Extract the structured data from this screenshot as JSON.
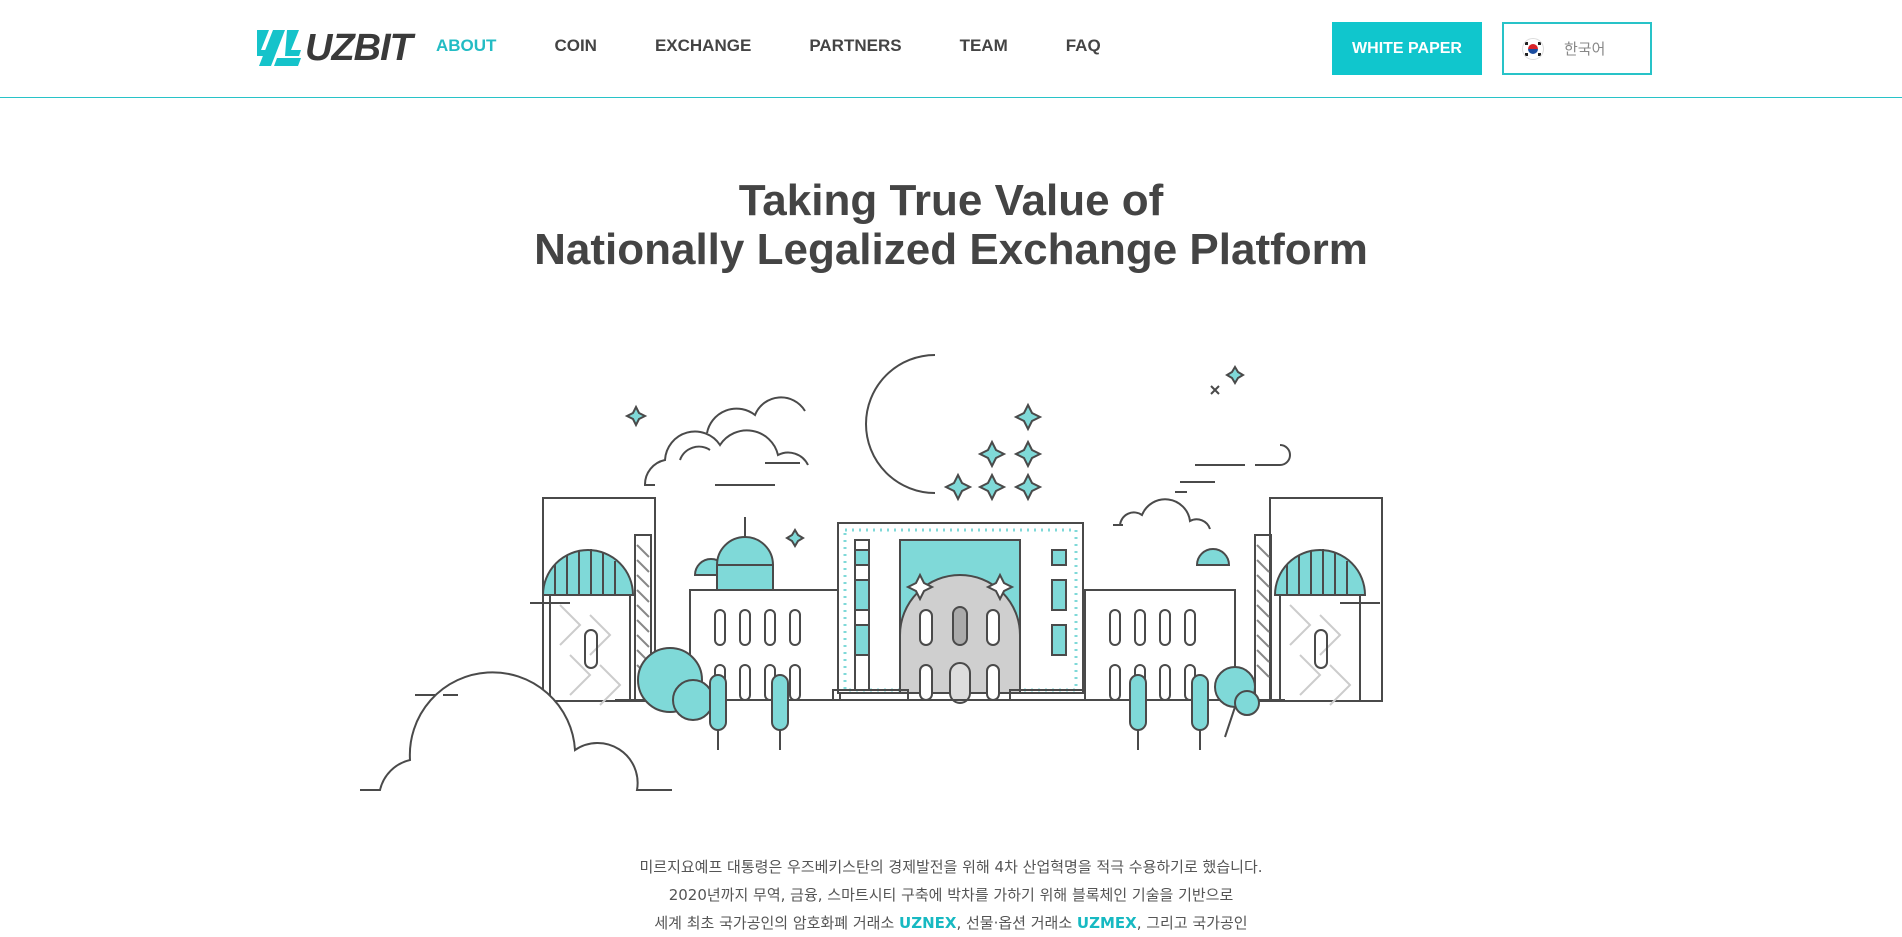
{
  "brand": {
    "logo_text": "UZBIT",
    "accent_color": "#10c6cd",
    "text_color": "#444444"
  },
  "nav": {
    "items": [
      {
        "label": "ABOUT",
        "active": true
      },
      {
        "label": "COIN",
        "active": false
      },
      {
        "label": "EXCHANGE",
        "active": false
      },
      {
        "label": "PARTNERS",
        "active": false
      },
      {
        "label": "TEAM",
        "active": false
      },
      {
        "label": "FAQ",
        "active": false
      }
    ]
  },
  "header": {
    "whitepaper_label": "WHITE PAPER",
    "language": {
      "selected": "한국어",
      "flag_icon": "south-korea-flag-icon"
    }
  },
  "hero": {
    "title_line1": "Taking True Value of",
    "title_line2": "Nationally Legalized Exchange Platform"
  },
  "intro": {
    "line1": "미르지요예프 대통령은 우즈베키스탄의 경제발전을 위해 4차 산업혁명을 적극 수용하기로 했습니다.",
    "line2": "2020년까지 무역, 금융, 스마트시티 구축에 박차를 가하기 위해 블록체인 기술을 기반으로",
    "line3_pre": "세계 최초 국가공인의 암호화폐 거래소 ",
    "line3_hl1": "UZNEX",
    "line3_mid": ", 선물·옵션 거래소 ",
    "line3_hl2": "UZMEX",
    "line3_post": ", 그리고 국가공인"
  }
}
